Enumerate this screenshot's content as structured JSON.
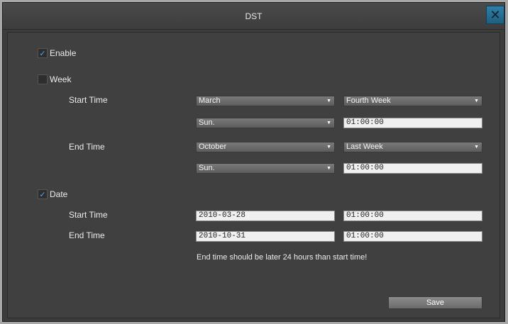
{
  "window": {
    "title": "DST",
    "close_symbol": "✕"
  },
  "enable": {
    "label": "Enable",
    "checked": true,
    "check_mark": "✓"
  },
  "week": {
    "label": "Week",
    "checked": false,
    "start": {
      "label": "Start Time",
      "month": "March",
      "week": "Fourth Week",
      "day": "Sun.",
      "time": "01:00:00"
    },
    "end": {
      "label": "End Time",
      "month": "October",
      "week": "Last Week",
      "day": "Sun.",
      "time": "01:00:00"
    }
  },
  "date": {
    "label": "Date",
    "checked": true,
    "check_mark": "✓",
    "start": {
      "label": "Start Time",
      "date": "2010-03-28",
      "time": "01:00:00"
    },
    "end": {
      "label": "End Time",
      "date": "2010-10-31",
      "time": "01:00:00"
    }
  },
  "message": "End time should be later 24 hours than start time!",
  "save_label": "Save",
  "icons": {
    "dropdown_arrow": "▼"
  }
}
